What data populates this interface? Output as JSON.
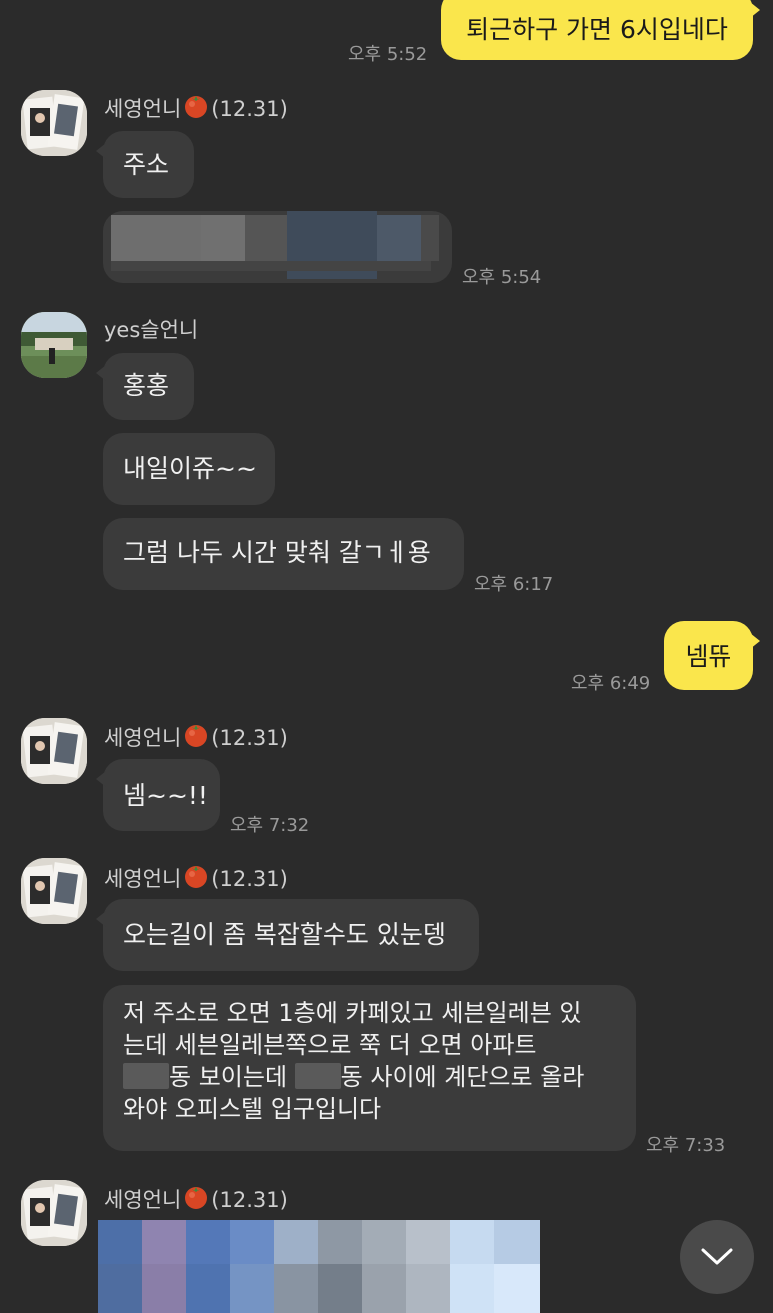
{
  "messages": {
    "m1_text": "퇴근하구 가면 6시입네다",
    "m1_time": "오후 5:52",
    "g1_name": "세영언니",
    "g1_suffix": "(12.31)",
    "g1_b1": "주소",
    "g1_time": "오후 5:54",
    "g2_name": "yes슬언니",
    "g2_b1": "홍홍",
    "g2_b2": "내일이쥬~~",
    "g2_b3": "그럼 나두 시간 맞춰 갈ㄱㅔ용",
    "g2_time": "오후 6:17",
    "m2_text": "넴뜌",
    "m2_time": "오후 6:49",
    "g3_name": "세영언니",
    "g3_suffix": "(12.31)",
    "g3_b1": "넴~~!!",
    "g3_time": "오후 7:32",
    "g4_name": "세영언니",
    "g4_suffix": "(12.31)",
    "g4_b1": "오는길이 좀 복잡할수도 있눈뎅",
    "g4_b2_l1": "저 주소로 오면 1층에 카페있고 세븐일레븐 있",
    "g4_b2_l2": "는데 세븐일레븐쪽으로 쭉 더 오면 아파트",
    "g4_b2_l3a": "동 보이는데",
    "g4_b2_l3b": "동 사이에 계단으로 올라",
    "g4_b2_l4": "와야 오피스텔 입구입니다",
    "g4_time": "오후 7:33",
    "g5_name": "세영언니",
    "g5_suffix": "(12.31)"
  },
  "icons": {
    "tomato": "tomato-emoji-icon",
    "scroll_down": "chevron-down-icon"
  },
  "colors": {
    "background": "#2b2b2b",
    "bubble_other": "#3b3b3b",
    "bubble_mine": "#fae64c"
  }
}
